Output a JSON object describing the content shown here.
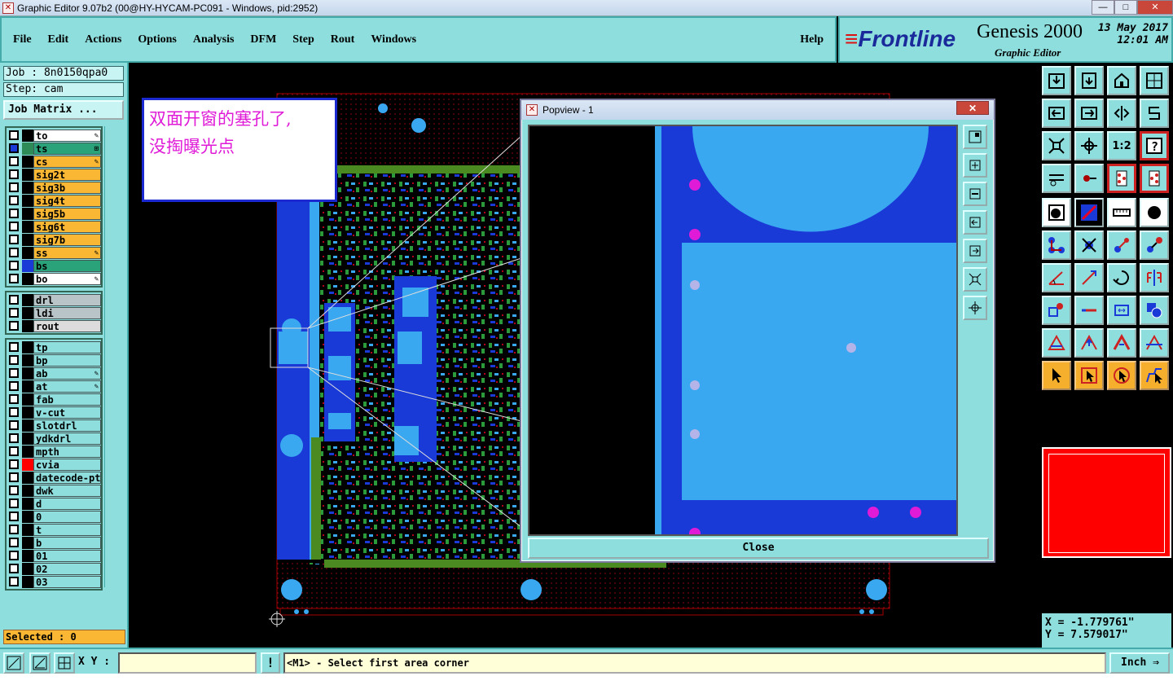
{
  "window": {
    "title": "Graphic Editor 9.07b2 (00@HY-HYCAM-PC091 - Windows, pid:2952)",
    "minimize": "—",
    "maximize": "□",
    "close": "✕"
  },
  "menu": {
    "items": [
      "File",
      "Edit",
      "Actions",
      "Options",
      "Analysis",
      "DFM",
      "Step",
      "Rout",
      "Windows"
    ],
    "help": "Help"
  },
  "brand": {
    "logo": "Frontline",
    "product": "Genesis 2000",
    "subtitle": "Graphic Editor",
    "date": "13 May 2017",
    "time": "12:01 AM"
  },
  "job": {
    "job_label": "Job : 8n0150qpa0",
    "step_label": "Step: cam",
    "job_matrix": "Job Matrix ..."
  },
  "layers": {
    "board": [
      {
        "name": "to",
        "color": "#ffffff",
        "swatch": "#000000",
        "mark": "✎"
      },
      {
        "name": "ts",
        "color": "#2aa37a",
        "swatch": "#2e8b57",
        "mark": "⊞",
        "checked": true
      },
      {
        "name": "cs",
        "color": "#f9b733",
        "swatch": "#000000",
        "mark": "✎"
      },
      {
        "name": "sig2t",
        "color": "#f9b733",
        "swatch": "#000000"
      },
      {
        "name": "sig3b",
        "color": "#f9b733",
        "swatch": "#000000"
      },
      {
        "name": "sig4t",
        "color": "#f9b733",
        "swatch": "#000000"
      },
      {
        "name": "sig5b",
        "color": "#f9b733",
        "swatch": "#000000"
      },
      {
        "name": "sig6t",
        "color": "#f9b733",
        "swatch": "#000000"
      },
      {
        "name": "sig7b",
        "color": "#f9b733",
        "swatch": "#000000"
      },
      {
        "name": "ss",
        "color": "#f9b733",
        "swatch": "#000000",
        "mark": "✎"
      },
      {
        "name": "bs",
        "color": "#2aa37a",
        "swatch": "#1a3ad8"
      },
      {
        "name": "bo",
        "color": "#ffffff",
        "swatch": "#000000",
        "mark": "✎"
      }
    ],
    "drill": [
      {
        "name": "drl",
        "color": "#b8c4c8",
        "swatch": "#000000"
      },
      {
        "name": "ldi",
        "color": "#b8c4c8",
        "swatch": "#000000"
      },
      {
        "name": "rout",
        "color": "#dcdcdc",
        "swatch": "#000000"
      }
    ],
    "misc": [
      {
        "name": "tp",
        "color": "#8fdede",
        "swatch": "#000000"
      },
      {
        "name": "bp",
        "color": "#8fdede",
        "swatch": "#000000"
      },
      {
        "name": "ab",
        "color": "#8fdede",
        "swatch": "#000000",
        "mark": "✎"
      },
      {
        "name": "at",
        "color": "#8fdede",
        "swatch": "#000000",
        "mark": "✎"
      },
      {
        "name": "fab",
        "color": "#8fdede",
        "swatch": "#000000"
      },
      {
        "name": "v-cut",
        "color": "#8fdede",
        "swatch": "#000000"
      },
      {
        "name": "slotdrl",
        "color": "#8fdede",
        "swatch": "#000000"
      },
      {
        "name": "ydkdrl",
        "color": "#8fdede",
        "swatch": "#000000"
      },
      {
        "name": "mpth",
        "color": "#8fdede",
        "swatch": "#000000"
      },
      {
        "name": "cvia",
        "color": "#8fdede",
        "swatch": "#ff0000"
      },
      {
        "name": "datecode-ptc",
        "color": "#8fdede",
        "swatch": "#000000"
      },
      {
        "name": "dwk",
        "color": "#8fdede",
        "swatch": "#000000"
      },
      {
        "name": "d",
        "color": "#8fdede",
        "swatch": "#000000"
      },
      {
        "name": "0",
        "color": "#8fdede",
        "swatch": "#000000"
      },
      {
        "name": "t",
        "color": "#8fdede",
        "swatch": "#000000"
      },
      {
        "name": "b",
        "color": "#8fdede",
        "swatch": "#000000"
      },
      {
        "name": "01",
        "color": "#8fdede",
        "swatch": "#000000"
      },
      {
        "name": "02",
        "color": "#8fdede",
        "swatch": "#000000"
      },
      {
        "name": "03",
        "color": "#8fdede",
        "swatch": "#000000"
      }
    ]
  },
  "selected": "Selected : 0",
  "annotation": {
    "line1": "双面开窗的塞孔了,",
    "line2": "没掏曝光点"
  },
  "popview": {
    "title": "Popview - 1",
    "close_button": "Close"
  },
  "coords": {
    "x": "X = -1.779761\"",
    "y": "Y = 7.579017\""
  },
  "status": {
    "xy_label": "X Y :",
    "xy_value": "",
    "prompt": "<M1> - Select first area corner",
    "unit": "Inch",
    "unit_arrow": "⇒"
  },
  "colors": {
    "panel": "#8fdede",
    "accent_blue": "#1a3ad8",
    "light_blue": "#3aa8f0",
    "green": "#4a8a20",
    "magenta": "#e01bd8"
  }
}
